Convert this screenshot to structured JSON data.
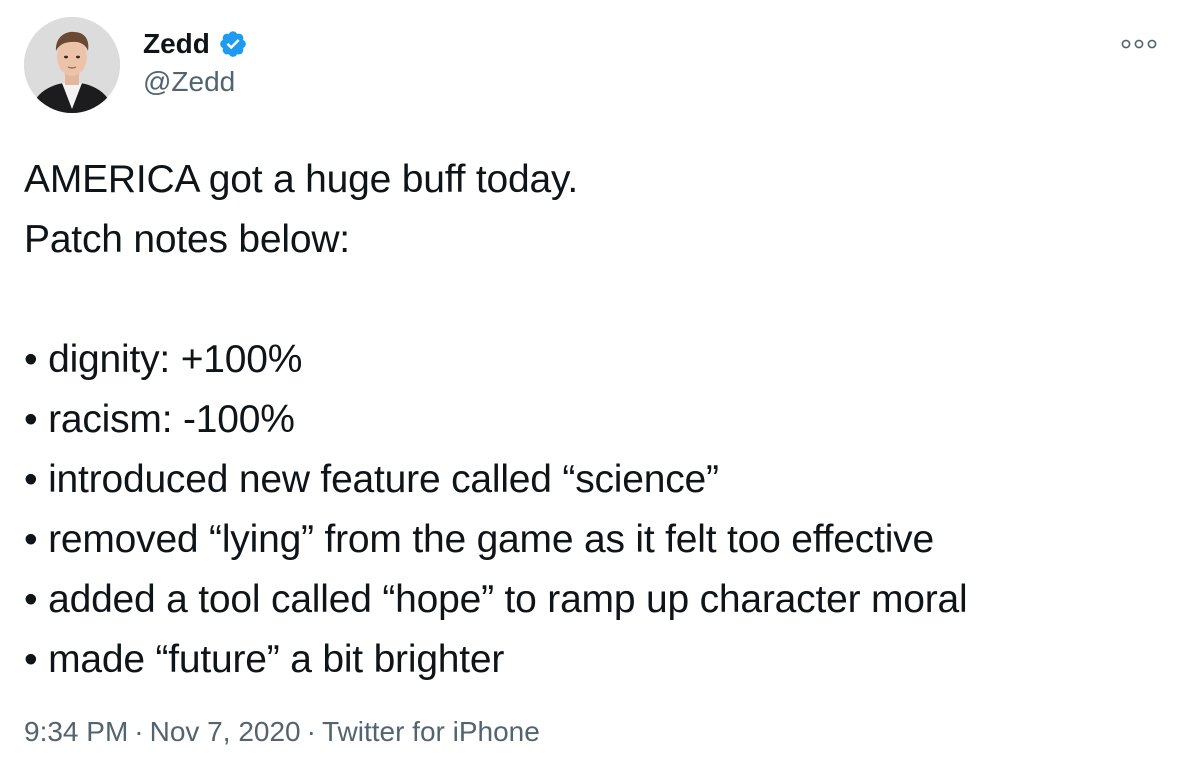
{
  "author": {
    "display_name": "Zedd",
    "handle": "@Zedd",
    "verified": true
  },
  "tweet": {
    "lines": [
      "AMERICA got a huge buff today.",
      "Patch notes below:",
      "",
      "• dignity: +100%",
      "• racism: -100%",
      "• introduced new feature called “science”",
      "• removed “lying” from the game as it felt too effective",
      "• added a tool called “hope” to ramp up character moral",
      "• made “future” a bit brighter"
    ],
    "time": "9:34 PM",
    "date": "Nov 7, 2020",
    "source": "Twitter for iPhone",
    "separator": "·"
  },
  "colors": {
    "text": "#0f1419",
    "secondary": "#536471",
    "verified_blue": "#1d9bf0"
  },
  "icons": {
    "verified": "verified-badge-icon",
    "more": "more-options-icon"
  }
}
